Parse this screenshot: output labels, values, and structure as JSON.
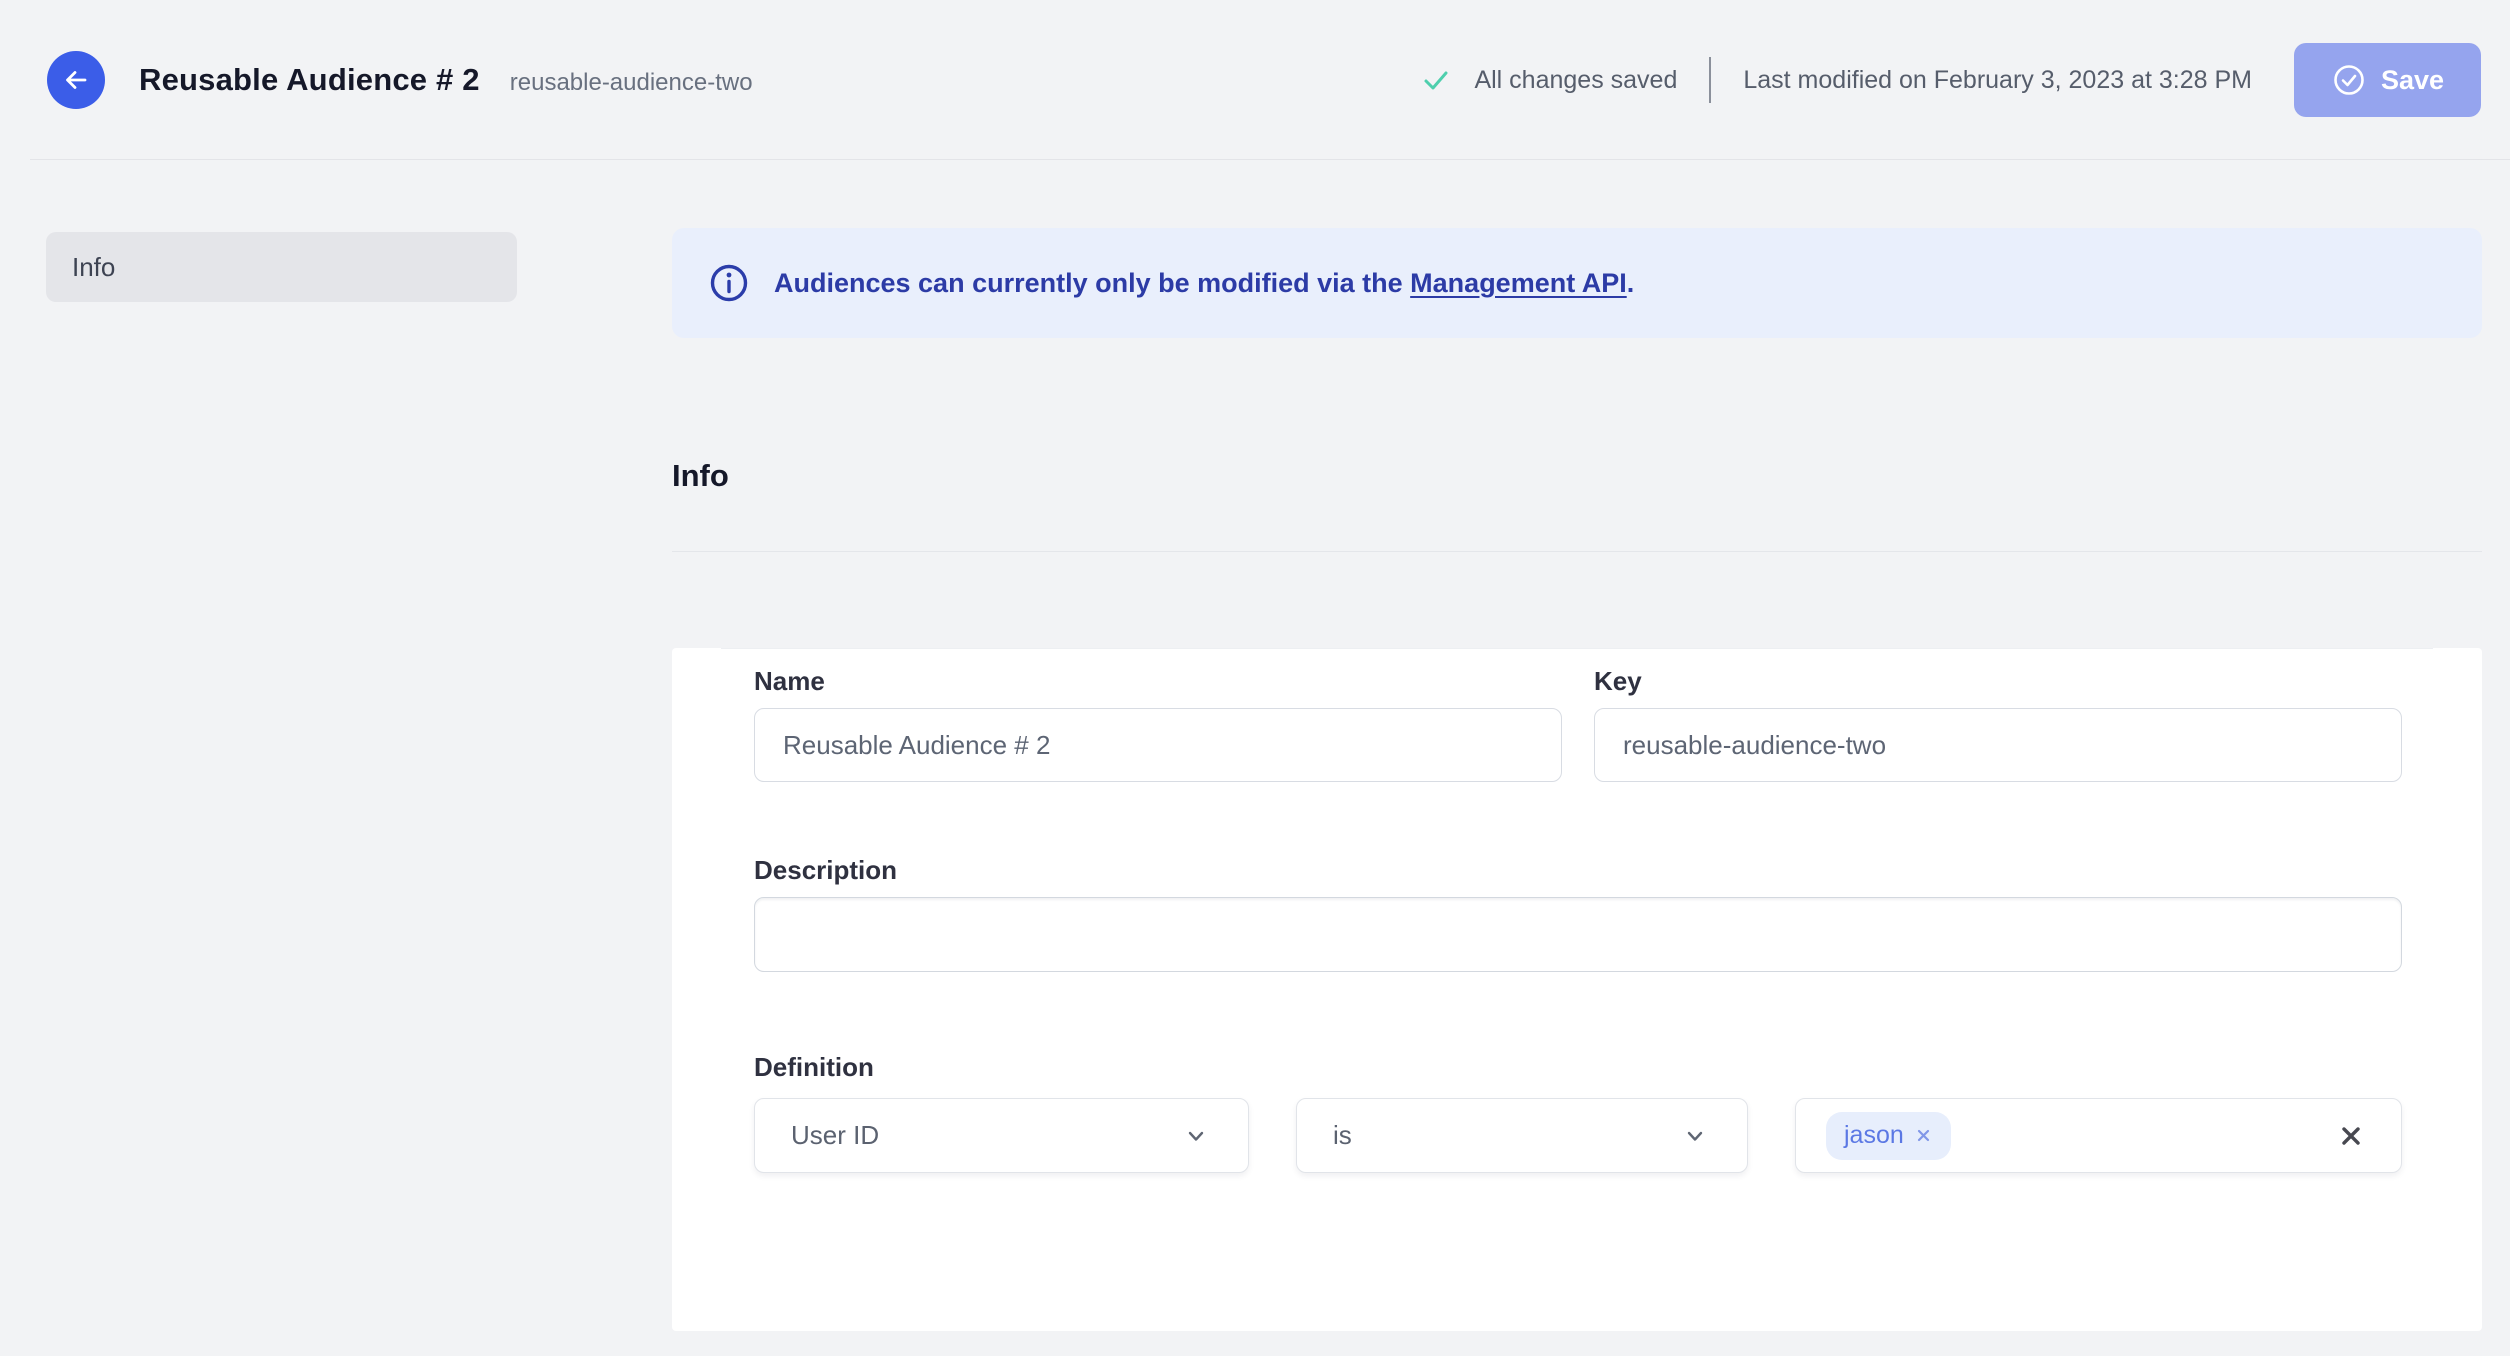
{
  "header": {
    "title": "Reusable Audience # 2",
    "subtitle": "reusable-audience-two",
    "saved_status": "All changes saved",
    "last_modified": "Last modified on February 3, 2023 at 3:28 PM",
    "save_label": "Save"
  },
  "sidebar": {
    "items": [
      {
        "label": "Info",
        "active": true
      }
    ]
  },
  "banner": {
    "text_before_link": "Audiences can currently only be modified via the ",
    "link_text": "Management API",
    "text_after_link": "."
  },
  "section": {
    "title": "Info"
  },
  "form": {
    "name": {
      "label": "Name",
      "value": "Reusable Audience # 2"
    },
    "key": {
      "label": "Key",
      "value": "reusable-audience-two"
    },
    "description": {
      "label": "Description",
      "value": ""
    },
    "definition": {
      "label": "Definition",
      "field_select": {
        "value": "User ID"
      },
      "operator_select": {
        "value": "is"
      },
      "values": [
        {
          "label": "jason"
        }
      ]
    }
  },
  "icons": {
    "back": "arrow-left-icon",
    "saved": "check-icon",
    "save": "circle-check-icon",
    "banner": "info-circle-icon",
    "selects": "chevron-down-icon",
    "chip_remove": "x-icon",
    "clear_values": "x-icon"
  },
  "colors": {
    "page_bg": "#f2f3f5",
    "accent_blue": "#3b5de8",
    "save_button_bg": "#95a4ee",
    "success_check": "#4ecfad",
    "banner_bg": "#e9effc",
    "banner_text": "#2c3ba6",
    "chip_bg": "#e7eefc",
    "chip_text": "#5b78e4",
    "card_bg": "#ffffff"
  }
}
